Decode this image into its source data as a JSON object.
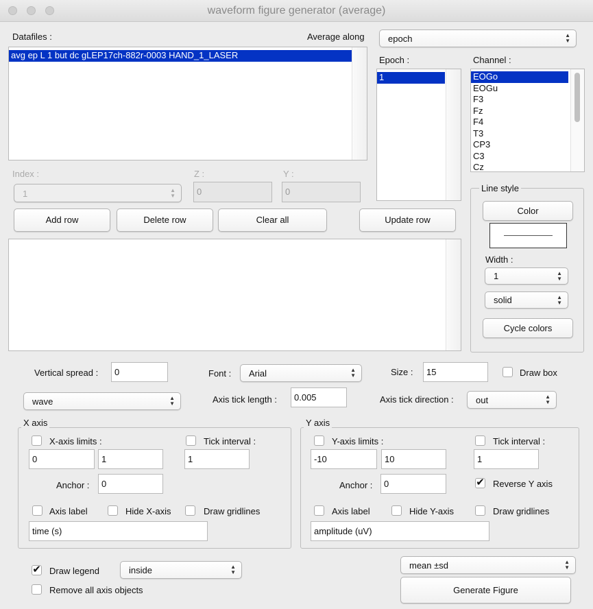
{
  "window": {
    "title": "waveform figure generator (average)"
  },
  "datafiles": {
    "label": "Datafiles :",
    "items": [
      "avg ep L  1 but dc gLEP17ch-882r-0003 HAND_1_LASER"
    ]
  },
  "average_along": {
    "label": "Average along",
    "value": "epoch"
  },
  "epoch": {
    "label": "Epoch :",
    "items": [
      "1"
    ]
  },
  "channel": {
    "label": "Channel :",
    "items": [
      "EOGo",
      "EOGu",
      "F3",
      "Fz",
      "F4",
      "T3",
      "CP3",
      "C3",
      "Cz"
    ],
    "selected": "EOGo"
  },
  "index": {
    "label": "Index :",
    "value": "1"
  },
  "z": {
    "label": "Z :",
    "value": "0"
  },
  "y": {
    "label": "Y :",
    "value": "0"
  },
  "buttons": {
    "add_row": "Add row",
    "delete_row": "Delete row",
    "clear_all": "Clear all",
    "update_row": "Update row",
    "generate": "Generate Figure"
  },
  "line_style": {
    "title": "Line style",
    "color_button": "Color",
    "width_label": "Width :",
    "width": "1",
    "style": "solid",
    "cycle_colors": "Cycle colors"
  },
  "vertical_spread": {
    "label": "Vertical spread :",
    "value": "0"
  },
  "font": {
    "label": "Font :",
    "value": "Arial"
  },
  "size": {
    "label": "Size :",
    "value": "15"
  },
  "draw_box": {
    "label": "Draw box",
    "checked": false
  },
  "plot_type": {
    "value": "wave"
  },
  "axis_tick_length": {
    "label": "Axis tick length :",
    "value": "0.005"
  },
  "axis_tick_direction": {
    "label": "Axis tick direction :",
    "value": "out"
  },
  "x_axis": {
    "title": "X axis",
    "limits_label": "X-axis limits :",
    "limits_checked": false,
    "min": "0",
    "max": "1",
    "tick_label": "Tick interval :",
    "tick_checked": false,
    "tick": "1",
    "anchor_label": "Anchor :",
    "anchor": "0",
    "axis_label": "Axis label",
    "hide": "Hide X-axis",
    "gridlines": "Draw gridlines",
    "label_value": "time (s)"
  },
  "y_axis": {
    "title": "Y axis",
    "limits_label": "Y-axis limits :",
    "limits_checked": false,
    "min": "-10",
    "max": "10",
    "tick_label": "Tick interval :",
    "tick_checked": false,
    "tick": "1",
    "anchor_label": "Anchor :",
    "anchor": "0",
    "reverse": "Reverse Y axis",
    "reverse_checked": true,
    "axis_label": "Axis label",
    "hide": "Hide Y-axis",
    "gridlines": "Draw gridlines",
    "label_value": "amplitude (uV)"
  },
  "legend": {
    "label": "Draw legend",
    "checked": true,
    "position": "inside"
  },
  "remove_axis": {
    "label": "Remove all axis objects",
    "checked": false
  },
  "stat": {
    "value": "mean ±sd"
  }
}
